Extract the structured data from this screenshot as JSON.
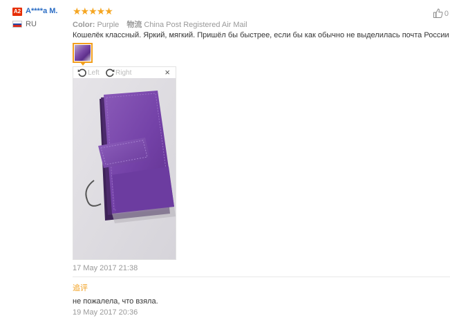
{
  "buyer": {
    "badge": "A2",
    "name": "A****a M.",
    "country": "RU"
  },
  "review": {
    "stars": "★★★★★",
    "rating": 5,
    "color_key": "Color:",
    "color_value": "Purple",
    "shipping_label": "物流",
    "shipping_value": "China Post Registered Air Mail",
    "text": "Кошелёк классный. Яркий, мягкий. Пришёл бы быстрее, если бы как обычно не выделилась почта России )))",
    "date": "17 May 2017 21:38"
  },
  "viewer": {
    "rotate_left": "Left",
    "rotate_right": "Right",
    "close": "×"
  },
  "additional": {
    "label": "追评",
    "text": "не пожалела, что взяла.",
    "date": "19 May 2017 20:36"
  },
  "like": {
    "count": "0"
  },
  "colors": {
    "accent": "#f29f1d",
    "name_blue": "#2a6cc4",
    "badge_red": "#e62e04",
    "star": "#f5a623",
    "purple": "#7b4aa8"
  }
}
